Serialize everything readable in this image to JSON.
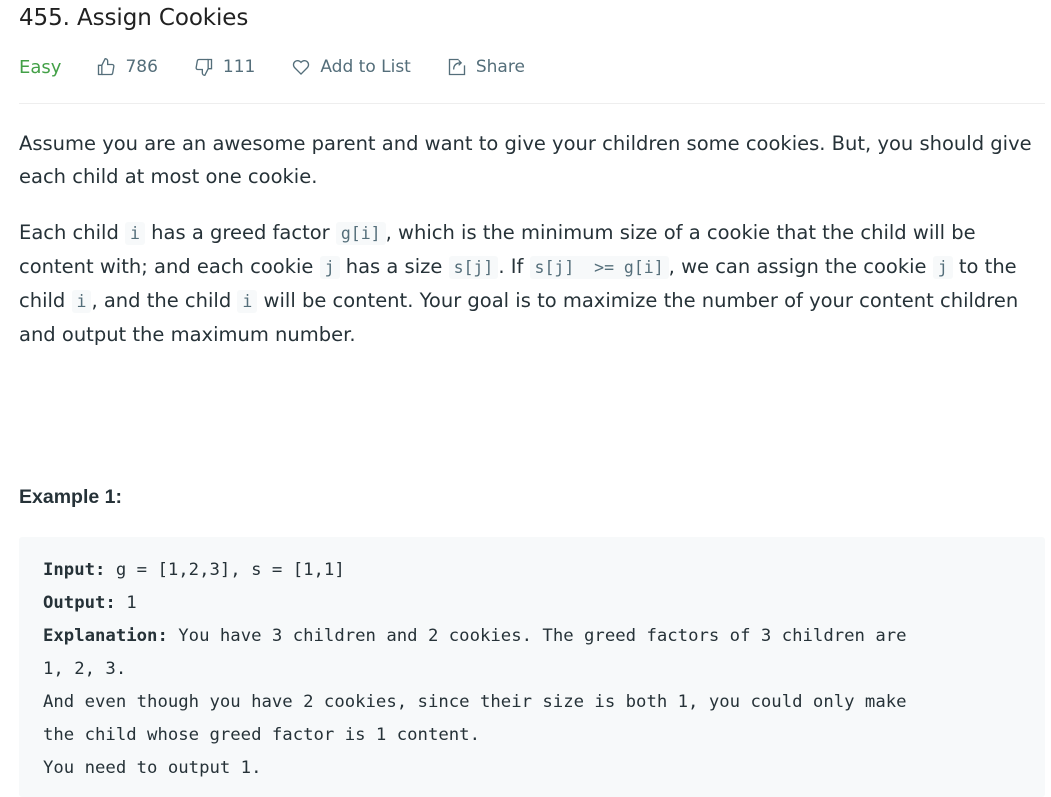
{
  "problem": {
    "title": "455. Assign Cookies",
    "difficulty": "Easy",
    "likes": "786",
    "dislikes": "111",
    "add_to_list_label": "Add to List",
    "share_label": "Share"
  },
  "description": {
    "p1": "Assume you are an awesome parent and want to give your children some cookies. But, you should give each child at most one cookie.",
    "p2": {
      "t1": "Each child ",
      "c1": "i",
      "t2": " has a greed factor ",
      "c2": "g[i]",
      "t3": ", which is the minimum size of a cookie that the child will be content with; and each cookie ",
      "c3": "j",
      "t4": " has a size ",
      "c4": "s[j]",
      "t5": ". If ",
      "c5": "s[j]  >= g[i]",
      "t6": ", we can assign the cookie ",
      "c6": "j",
      "t7": " to the child ",
      "c7": "i",
      "t8": ", and the child ",
      "c8": "i",
      "t9": " will be content. Your goal is to maximize the number of your content children and output the maximum number."
    }
  },
  "example1": {
    "title": "Example 1:",
    "input_label": "Input:",
    "input_value": " g = [1,2,3], s = [1,1]",
    "output_label": "Output:",
    "output_value": " 1",
    "explanation_label": "Explanation:",
    "explanation_line1": " You have 3 children and 2 cookies. The greed factors of 3 children are",
    "explanation_line2": "1, 2, 3.",
    "explanation_line3": "And even though you have 2 cookies, since their size is both 1, you could only make",
    "explanation_line4": "the child whose greed factor is 1 content.",
    "explanation_line5": "You need to output 1."
  },
  "colors": {
    "easy": "#43a047",
    "text": "#263238",
    "muted": "#546e7a",
    "code_bg": "#f7f9fa"
  },
  "icons": {
    "like": "thumbs-up-icon",
    "dislike": "thumbs-down-icon",
    "add": "heart-icon",
    "share": "share-icon"
  }
}
